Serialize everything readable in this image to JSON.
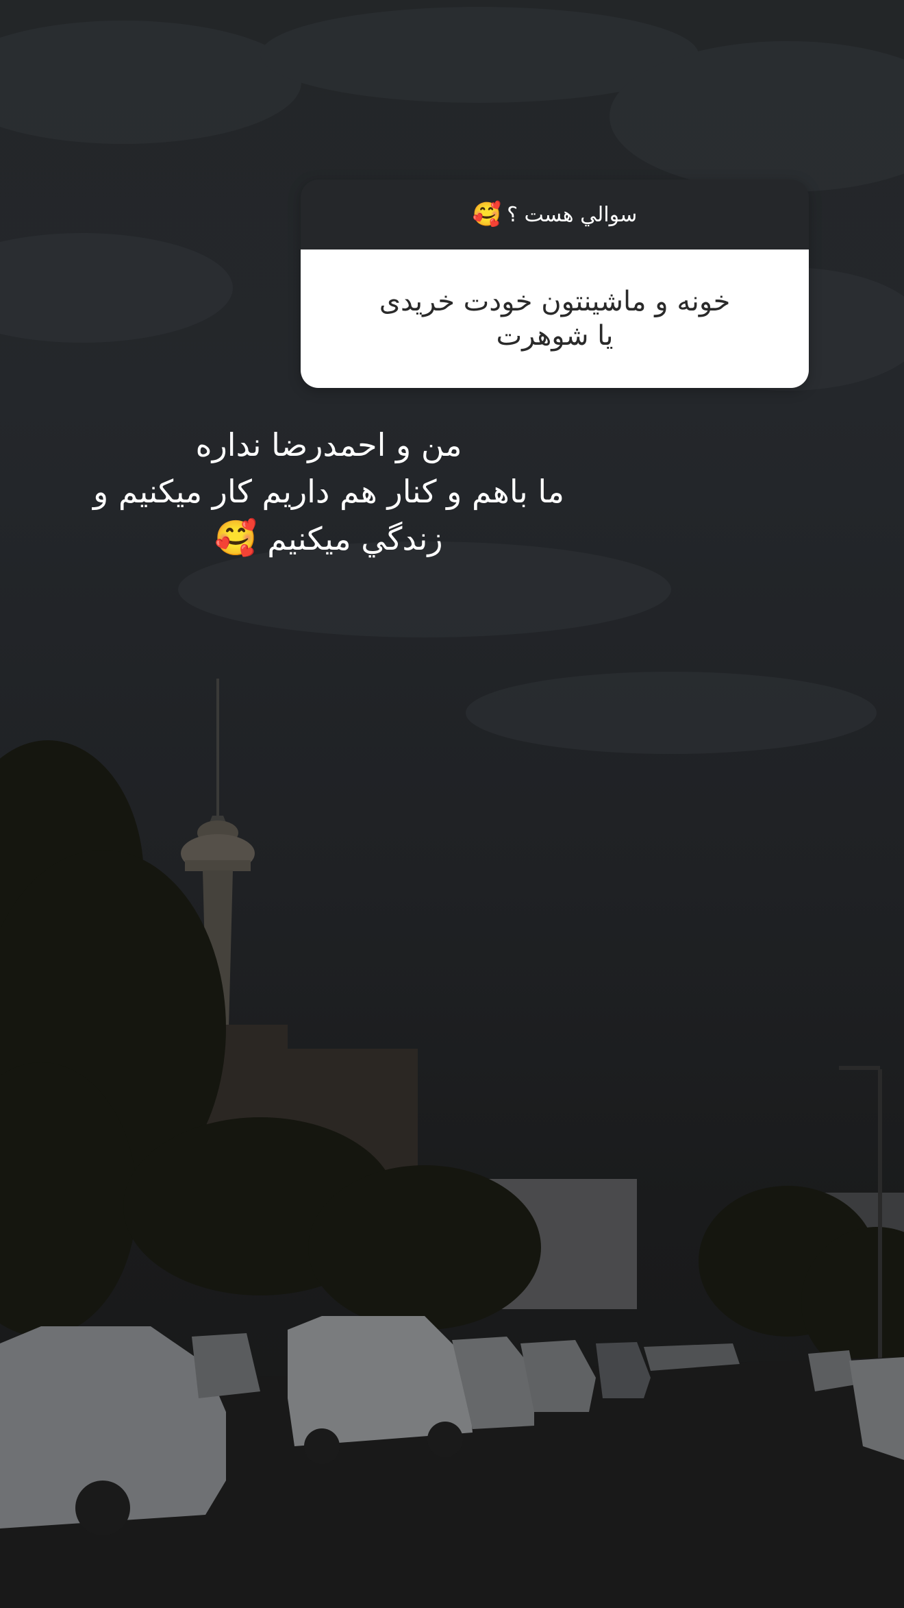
{
  "question_sticker": {
    "prompt": "سوالي هست ؟",
    "prompt_emoji": "🥰",
    "answer": "خونه و ماشینتون خودت خریدی\nیا شوهرت"
  },
  "reply": {
    "line1": "من و احمدرضا نداره",
    "line2": "ما باهم و کنار هم داریم کار میکنیم و",
    "line3": "زندگي میکنیم",
    "emoji": "🥰"
  },
  "colors": {
    "overlay": "#1f2124",
    "sticker_header": "#25272a",
    "sticker_body": "#ffffff",
    "text_light": "#ffffff",
    "text_dark": "#2a2a2a"
  }
}
